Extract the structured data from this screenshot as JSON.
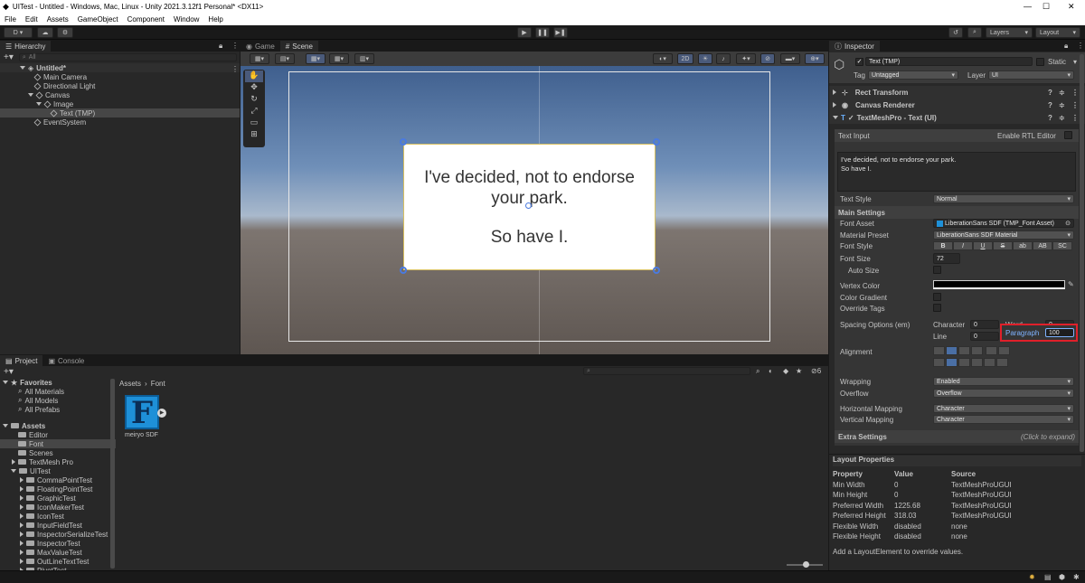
{
  "window": {
    "title": "UITest - Untitled - Windows, Mac, Linux - Unity 2021.3.12f1 Personal* <DX11>"
  },
  "menu": [
    "File",
    "Edit",
    "Assets",
    "GameObject",
    "Component",
    "Window",
    "Help"
  ],
  "toolbar": {
    "account": "D",
    "layers": "Layers",
    "layout": "Layout"
  },
  "hierarchy": {
    "tab": "Hierarchy",
    "search_placeholder": "All",
    "items": [
      {
        "label": "Untitled*",
        "depth": 0
      },
      {
        "label": "Main Camera",
        "depth": 1
      },
      {
        "label": "Directional Light",
        "depth": 1
      },
      {
        "label": "Canvas",
        "depth": 1
      },
      {
        "label": "Image",
        "depth": 2
      },
      {
        "label": "Text (TMP)",
        "depth": 3
      },
      {
        "label": "EventSystem",
        "depth": 1
      }
    ]
  },
  "scene": {
    "tabs": [
      "Game",
      "Scene"
    ],
    "toolbar_2d": "2D",
    "text_line1": "I've decided, not to endorse",
    "text_line2": "your park.",
    "text_line3": "So have I."
  },
  "project": {
    "tabs": [
      "Project",
      "Console"
    ],
    "breadcrumb": [
      "Assets",
      "Font"
    ],
    "count": "6",
    "favorites_label": "Favorites",
    "favorites": [
      "All Materials",
      "All Models",
      "All Prefabs"
    ],
    "assets_label": "Assets",
    "assets": [
      "Editor",
      "Font",
      "Scenes",
      "TextMesh Pro",
      "UITest"
    ],
    "uitest_children": [
      "CommaPointTest",
      "FloatingPointTest",
      "GraphicTest",
      "IconMakerTest",
      "IconTest",
      "InputFieldTest",
      "InspectorSerializeTest",
      "InspectorTest",
      "MaxValueTest",
      "OutLineTextTest",
      "PivotTest"
    ],
    "asset_item": {
      "label": "meiryo SDF",
      "glyph": "F"
    }
  },
  "inspector": {
    "tab": "Inspector",
    "object_name": "Text (TMP)",
    "static_label": "Static",
    "tag_label": "Tag",
    "tag_value": "Untagged",
    "layer_label": "Layer",
    "layer_value": "UI",
    "components": [
      "Rect Transform",
      "Canvas Renderer",
      "TextMeshPro - Text (UI)"
    ],
    "text_input_label": "Text Input",
    "rtl_label": "Enable RTL Editor",
    "text_value_line1": "I've decided, not to endorse your park.",
    "text_value_line2": "So have I.",
    "text_style_label": "Text Style",
    "text_style_value": "Normal",
    "main_settings": "Main Settings",
    "font_asset_label": "Font Asset",
    "font_asset_value": "LiberationSans SDF (TMP_Font Asset)",
    "material_preset_label": "Material Preset",
    "material_preset_value": "LiberationSans SDF Material",
    "font_style_label": "Font Style",
    "font_style_buttons": [
      "B",
      "I",
      "U",
      "S",
      "ab",
      "AB",
      "SC"
    ],
    "font_size_label": "Font Size",
    "font_size_value": "72",
    "auto_size_label": "Auto Size",
    "vertex_color_label": "Vertex Color",
    "color_gradient_label": "Color Gradient",
    "override_tags_label": "Override Tags",
    "spacing_label": "Spacing Options (em)",
    "character_label": "Character",
    "character_value": "0",
    "word_label": "Word",
    "word_value": "0",
    "line_label": "Line",
    "line_value": "0",
    "paragraph_label": "Paragraph",
    "paragraph_value": "100",
    "alignment_label": "Alignment",
    "wrapping_label": "Wrapping",
    "wrapping_value": "Enabled",
    "overflow_label": "Overflow",
    "overflow_value": "Overflow",
    "hmap_label": "Horizontal Mapping",
    "hmap_value": "Character",
    "vmap_label": "Vertical Mapping",
    "vmap_value": "Character",
    "extra_label": "Extra Settings",
    "extra_hint": "(Click to expand)",
    "highlight_color": "#e0202a"
  },
  "layout_props": {
    "title": "Layout Properties",
    "headers": [
      "Property",
      "Value",
      "Source"
    ],
    "rows": [
      [
        "Min Width",
        "0",
        "TextMeshProUGUI"
      ],
      [
        "Min Height",
        "0",
        "TextMeshProUGUI"
      ],
      [
        "Preferred Width",
        "1225.68",
        "TextMeshProUGUI"
      ],
      [
        "Preferred Height",
        "318.03",
        "TextMeshProUGUI"
      ],
      [
        "Flexible Width",
        "disabled",
        "none"
      ],
      [
        "Flexible Height",
        "disabled",
        "none"
      ]
    ],
    "footer": "Add a LayoutElement to override values."
  }
}
